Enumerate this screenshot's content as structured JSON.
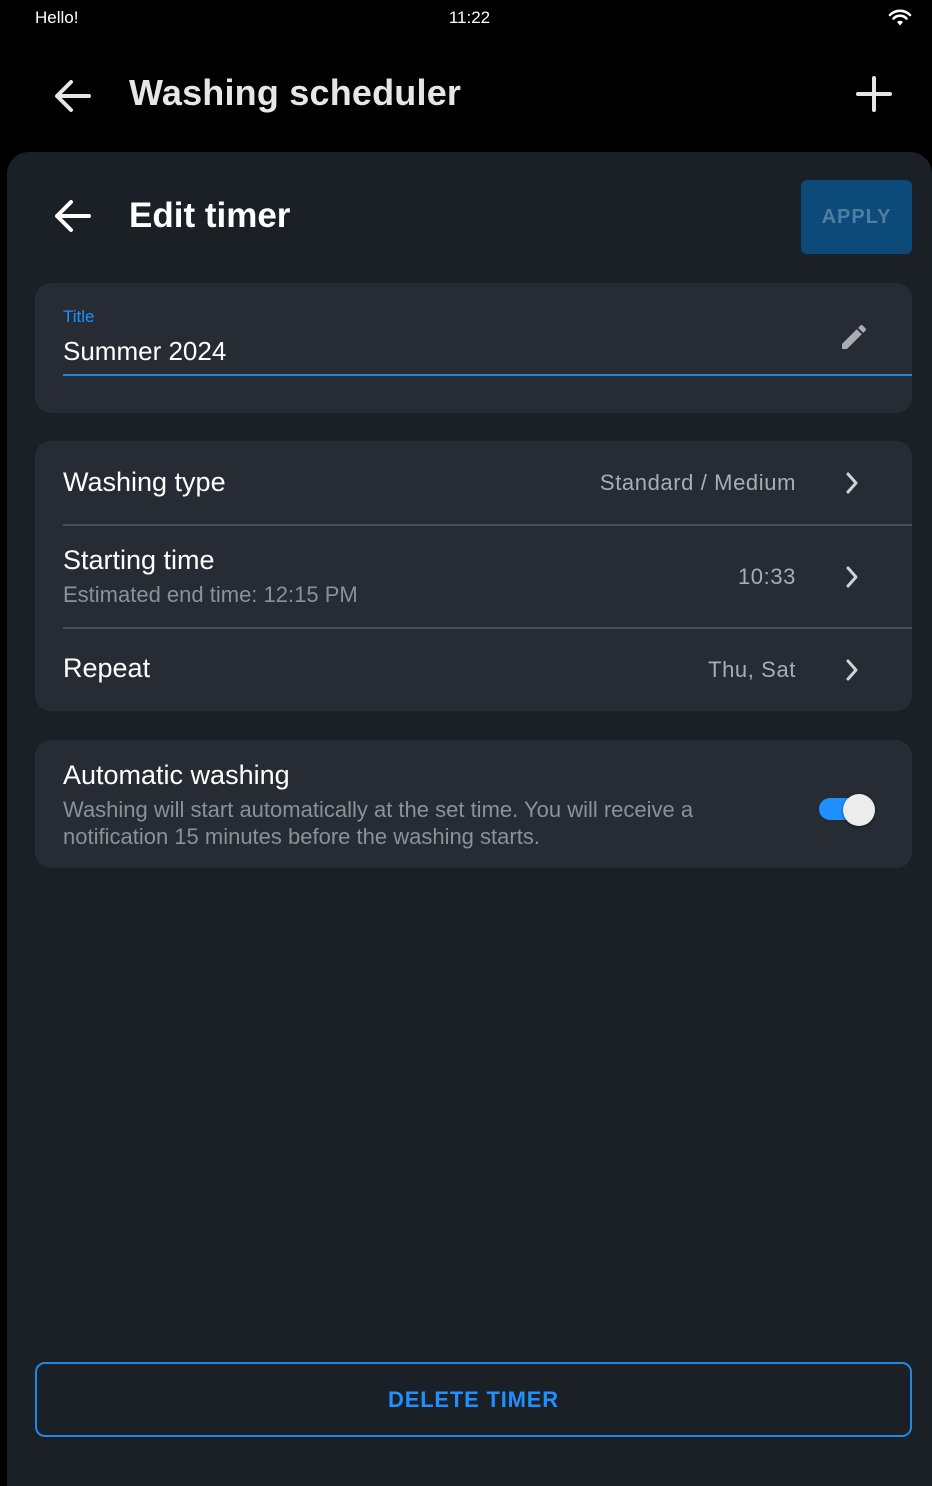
{
  "status_bar": {
    "left_text": "Hello!",
    "time": "11:22",
    "wifi_icon": "wifi-icon"
  },
  "app_bar": {
    "title": "Washing scheduler",
    "back_icon": "arrow-left-icon",
    "add_icon": "plus-icon"
  },
  "sheet": {
    "title": "Edit timer",
    "back_icon": "arrow-left-icon",
    "apply_label": "APPLY"
  },
  "title_field": {
    "label": "Title",
    "value": "Summer 2024",
    "edit_icon": "pencil-icon"
  },
  "settings": [
    {
      "label": "Washing type",
      "value": "Standard / Medium"
    },
    {
      "label": "Starting time",
      "sub": "Estimated end time: 12:15 PM",
      "value": "10:33"
    },
    {
      "label": "Repeat",
      "value": "Thu, Sat"
    }
  ],
  "automatic_washing": {
    "label": "Automatic washing",
    "description": "Washing will start automatically at the set time. You will receive a notification 15 minutes before the washing starts.",
    "enabled": true
  },
  "delete_label": "DELETE TIMER",
  "colors": {
    "accent": "#1e90ff",
    "background": "#000000",
    "sheet": "#1b1f26",
    "card": "#272c34",
    "apply_button": "#0c4a7a"
  }
}
